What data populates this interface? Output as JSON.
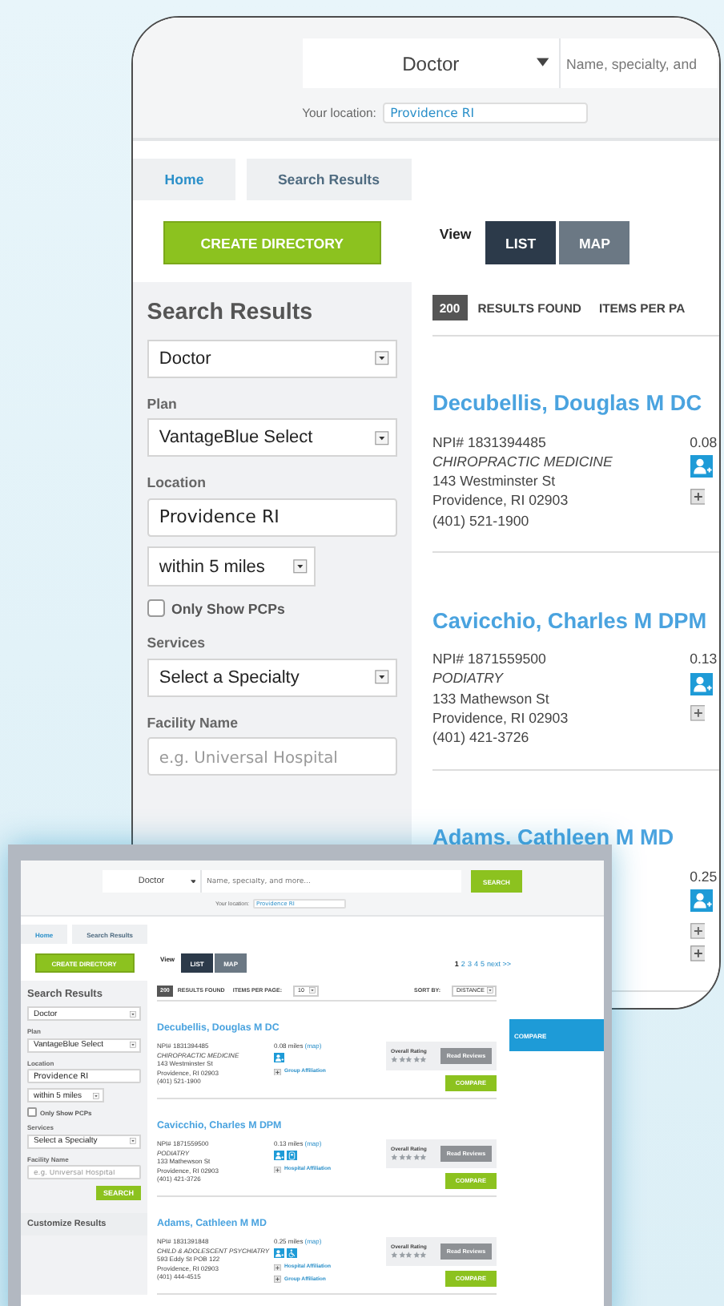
{
  "zoom_view": {
    "header": {
      "type_select": "Doctor",
      "search_placeholder": "Name, specialty, and",
      "location_label": "Your location:",
      "location_value": "Providence RI"
    },
    "breadcrumbs": [
      {
        "label": "Home",
        "kind": "link"
      },
      {
        "label": "Search Results",
        "kind": "current"
      }
    ],
    "create_button": "CREATE DIRECTORY",
    "view": {
      "label": "View",
      "tabs": [
        {
          "label": "LIST",
          "selected": true
        },
        {
          "label": "MAP",
          "selected": false
        }
      ]
    },
    "sidebar": {
      "title": "Search Results",
      "provider_type": "Doctor",
      "plan_label": "Plan",
      "plan": "VantageBlue Select",
      "location_label": "Location",
      "location": "Providence RI",
      "radius": "within 5 miles",
      "pcp": {
        "label": "Only Show PCPs",
        "checked": false
      },
      "services_label": "Services",
      "services": "Select a Specialty",
      "facility_label": "Facility Name",
      "facility_placeholder": "e.g. Universal Hospital"
    },
    "results_bar": {
      "count": "200",
      "found_label": "RESULTS FOUND",
      "per_page_label": "ITEMS PER PA"
    },
    "results": [
      {
        "name": "Decubellis, Douglas M DC",
        "npi": "NPI# 1831394485",
        "specialty": "CHIROPRACTIC MEDICINE",
        "address": [
          "143 Westminster St",
          "Providence, RI 02903"
        ],
        "phone": "(401) 521-1900",
        "distance": "0.08",
        "badges": [
          {
            "kind": "person-add"
          }
        ],
        "affiliations": [
          {
            "kind": "group"
          }
        ]
      },
      {
        "name": "Cavicchio, Charles M DPM",
        "npi": "NPI# 1871559500",
        "specialty": "PODIATRY",
        "address": [
          "133 Mathewson St",
          "Providence, RI 02903"
        ],
        "phone": "(401) 421-3726",
        "distance": "0.13",
        "badges": [
          {
            "kind": "person-add"
          }
        ],
        "affiliations": [
          {
            "kind": "hospital"
          }
        ]
      },
      {
        "name": "Adams, Cathleen M MD",
        "distance": "0.25",
        "badges": [
          {
            "kind": "person-add"
          }
        ],
        "affiliations": [
          {
            "kind": "hospital"
          },
          {
            "kind": "group"
          }
        ]
      }
    ]
  },
  "screenshot": {
    "header": {
      "type_select": "Doctor",
      "search_placeholder": "Name, specialty, and more...",
      "search_button": "SEARCH",
      "location_label": "Your location:",
      "location_value": "Providence RI"
    },
    "breadcrumbs": [
      {
        "label": "Home",
        "kind": "link"
      },
      {
        "label": "Search Results",
        "kind": "current"
      }
    ],
    "create_button": "CREATE DIRECTORY",
    "view": {
      "label": "View",
      "tabs": [
        {
          "label": "LIST",
          "selected": true
        },
        {
          "label": "MAP",
          "selected": false
        }
      ]
    },
    "pagination": [
      {
        "label": "1",
        "selected": true
      },
      {
        "label": "2",
        "selected": false
      },
      {
        "label": "3",
        "selected": false
      },
      {
        "label": "4",
        "selected": false
      },
      {
        "label": "5",
        "selected": false
      },
      {
        "label": "next >>",
        "selected": false
      }
    ],
    "sidebar": {
      "title": "Search Results",
      "provider_type": "Doctor",
      "plan_label": "Plan",
      "plan": "VantageBlue Select",
      "location_label": "Location",
      "location": "Providence RI",
      "radius": "within 5 miles",
      "pcp": {
        "label": "Only Show PCPs",
        "checked": false
      },
      "services_label": "Services",
      "services": "Select a Specialty",
      "facility_label": "Facility Name",
      "facility_placeholder": "e.g. Universal Hospital",
      "search_button": "SEARCH",
      "customize_title": "Customize Results"
    },
    "results_bar": {
      "count": "200",
      "found_label": "RESULTS FOUND",
      "per_page_label": "ITEMS PER PAGE:",
      "per_page": "10",
      "sort_label": "SORT BY:",
      "sort": "DISTANCE"
    },
    "compare_panel": "COMPARE",
    "results": [
      {
        "name": "Decubellis, Douglas M DC",
        "npi": "NPI# 1831394485",
        "specialty": "CHIROPRACTIC MEDICINE",
        "address": [
          "143 Westminster St",
          "Providence, RI 02903"
        ],
        "phone": "(401) 521-1900",
        "distance": "0.08 miles",
        "map_link": "(map)",
        "badges": [
          {
            "kind": "person-add"
          }
        ],
        "affiliations": [
          {
            "kind": "group",
            "label": "Group Affiliation"
          }
        ],
        "rating": {
          "label": "Overall Rating",
          "stars": 0,
          "reviews_button": "Read Reviews"
        },
        "compare": "COMPARE"
      },
      {
        "name": "Cavicchio, Charles M DPM",
        "npi": "NPI# 1871559500",
        "specialty": "PODIATRY",
        "address": [
          "133 Mathewson St",
          "Providence, RI 02903"
        ],
        "phone": "(401) 421-3726",
        "distance": "0.13 miles",
        "map_link": "(map)",
        "badges": [
          {
            "kind": "person-add"
          },
          {
            "kind": "person-outline"
          }
        ],
        "affiliations": [
          {
            "kind": "hospital",
            "label": "Hospital Affiliation"
          }
        ],
        "rating": {
          "label": "Overall Rating",
          "stars": 0,
          "reviews_button": "Read Reviews"
        },
        "compare": "COMPARE"
      },
      {
        "name": "Adams, Cathleen M MD",
        "npi": "NPI# 1831391848",
        "specialty": "CHILD & ADOLESCENT PSYCHIATRY",
        "address": [
          "593 Eddy St POB 122",
          "Providence, RI 02903"
        ],
        "phone": "(401) 444-4515",
        "distance": "0.25 miles",
        "map_link": "(map)",
        "badges": [
          {
            "kind": "person-add"
          },
          {
            "kind": "wheelchair"
          }
        ],
        "affiliations": [
          {
            "kind": "hospital",
            "label": "Hospital Affiliation"
          },
          {
            "kind": "group",
            "label": "Group Affiliation"
          }
        ],
        "rating": {
          "label": "Overall Rating",
          "stars": 0,
          "reviews_button": "Read Reviews"
        },
        "compare": "COMPARE"
      }
    ]
  }
}
